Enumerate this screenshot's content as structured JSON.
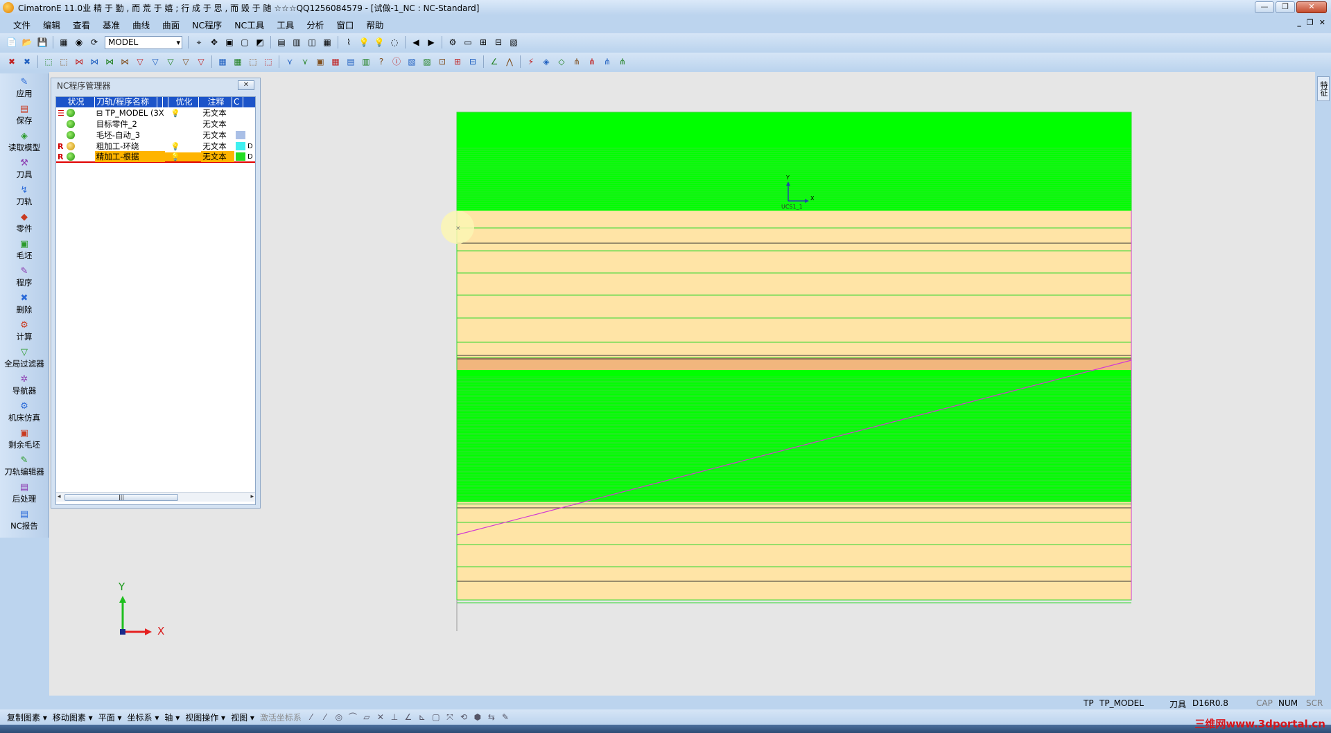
{
  "window": {
    "title": "CimatronE 11.0业 精 于 勤 , 而 荒 于 嬉 ; 行 成 于 思 , 而 毁 于 随 ☆☆☆QQ1256084579 - [试做-1_NC : NC-Standard]",
    "minimize": "—",
    "restore": "❐",
    "close": "✕"
  },
  "menu": [
    "文件",
    "编辑",
    "查看",
    "基准",
    "曲线",
    "曲面",
    "NC程序",
    "NC工具",
    "工具",
    "分析",
    "窗口",
    "帮助"
  ],
  "mdi_controls": [
    "_",
    "❐",
    "✕"
  ],
  "toolbar1": {
    "model_select": "MODEL",
    "icons_left": [
      "📄",
      "📂",
      "💾"
    ],
    "icons_right": [
      "▦",
      "◉",
      "⟳",
      "⌖",
      "✥",
      "▣",
      "▢",
      "◩",
      "▤",
      "▥",
      "◫",
      "▦",
      "⌇",
      "💡",
      "💡",
      "◌",
      "◀",
      "▶",
      "⚙",
      "▭",
      "⊞",
      "⊟",
      "▧"
    ]
  },
  "toolbar2": {
    "icons": [
      "✖",
      "✖",
      "⬚",
      "⬚",
      "⋈",
      "⋈",
      "⋈",
      "⋈",
      "▽",
      "▽",
      "▽",
      "▽",
      "▽",
      "▦",
      "▦",
      "⬚",
      "⬚",
      "⋎",
      "⋎",
      "▣",
      "▦",
      "▤",
      "▥",
      "?",
      "ⓘ",
      "▧",
      "▨",
      "⊡",
      "⊞",
      "⊟",
      "∠",
      "⋀",
      "⚡",
      "◈",
      "◇",
      "⋔",
      "⋔",
      "⋔",
      "⋔"
    ]
  },
  "leftbar": [
    {
      "label": "应用",
      "icon": "✎"
    },
    {
      "label": "保存",
      "icon": "▤"
    },
    {
      "label": "读取模型",
      "icon": "◈"
    },
    {
      "label": "刀具",
      "icon": "⚒"
    },
    {
      "label": "刀轨",
      "icon": "↯"
    },
    {
      "label": "零件",
      "icon": "◆"
    },
    {
      "label": "毛坯",
      "icon": "▣"
    },
    {
      "label": "程序",
      "icon": "✎"
    },
    {
      "label": "删除",
      "icon": "✖"
    },
    {
      "label": "计算",
      "icon": "⚙"
    },
    {
      "label": "全局过滤器",
      "icon": "▽"
    },
    {
      "label": "导航器",
      "icon": "✲"
    },
    {
      "label": "机床仿真",
      "icon": "⚙"
    },
    {
      "label": "剩余毛坯",
      "icon": "▣"
    },
    {
      "label": "刀轨编辑器",
      "icon": "✎"
    },
    {
      "label": "后处理",
      "icon": "▤"
    },
    {
      "label": "NC报告",
      "icon": "▤"
    }
  ],
  "nc_manager": {
    "title": "NC程序管理器",
    "close": "✕",
    "columns": [
      "状况",
      "刀轨/程序名称",
      "",
      "",
      "优化",
      "注释",
      "C"
    ],
    "rows": [
      {
        "flag": "☰",
        "status": "green",
        "name": "⊟ TP_MODEL (3X",
        "icon": "💡",
        "note": "无文本",
        "color": "",
        "extra": ""
      },
      {
        "flag": "",
        "status": "green",
        "name": "目标零件_2",
        "icon": "",
        "note": "无文本",
        "color": "",
        "extra": ""
      },
      {
        "flag": "",
        "status": "green",
        "name": "毛坯-自动_3",
        "icon": "",
        "note": "无文本",
        "color": "#a9bfe6",
        "extra": ""
      },
      {
        "flag": "R",
        "status": "orange",
        "name": "粗加工-环绕",
        "icon": "💡",
        "note": "无文本",
        "color": "#3ff0f0",
        "extra": "D"
      },
      {
        "flag": "R",
        "status": "green",
        "name": "精加工-根据",
        "icon": "💡",
        "note": "无文本",
        "color": "#22dd22",
        "extra": "D"
      }
    ],
    "scroll_thumb": "|||",
    "scroll_left": "◂",
    "scroll_right": "▸"
  },
  "viewport": {
    "ucs_label": "UCS1_1",
    "ucs_x": "X",
    "ucs_y": "Y",
    "triad_x": "X",
    "triad_y": "Y",
    "colors": {
      "green": "#00ff00",
      "part": "#ffe4a6",
      "toolpath": "#d23ad2"
    }
  },
  "right_tab": "特征",
  "statusbar": {
    "tp_label": "TP",
    "tp_value": "TP_MODEL",
    "tool_label": "刀具",
    "tool_value": "D16R0.8",
    "cap": "CAP",
    "num": "NUM",
    "scr": "SCR"
  },
  "bottombar": [
    "复制图素 ▾",
    "移动图素 ▾",
    "平面 ▾",
    "坐标系 ▾",
    "轴 ▾",
    "视图操作 ▾",
    "视图 ▾"
  ],
  "bottombar_disabled": "激活坐标系",
  "watermark": "三维网www.3dportal.cn"
}
